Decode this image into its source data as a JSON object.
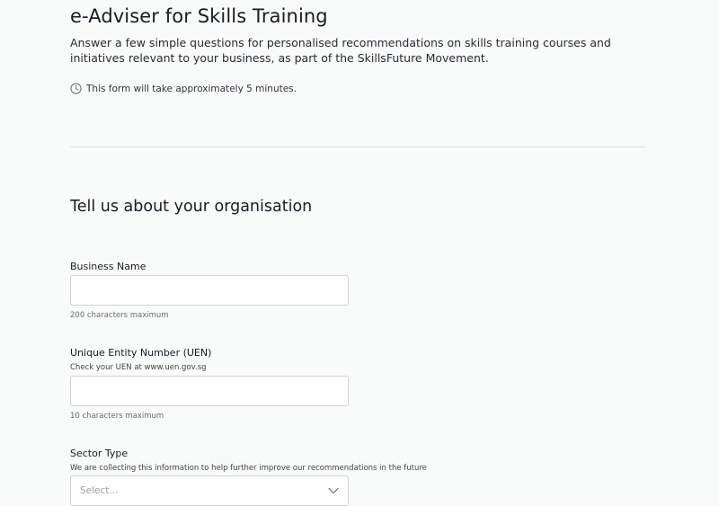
{
  "header": {
    "title": "e-Adviser for Skills Training",
    "intro": "Answer a few simple questions for personalised recommendations on skills training courses and initiatives relevant to your business, as part of the SkillsFuture Movement.",
    "timing_text": "This form will take approximately 5 minutes.",
    "timing_icon": "clock-icon"
  },
  "section": {
    "title": "Tell us about your organisation"
  },
  "fields": {
    "business_name": {
      "label": "Business Name",
      "value": "",
      "hint": "200 characters maximum"
    },
    "uen": {
      "label": "Unique Entity Number (UEN)",
      "help": "Check your UEN at www.uen.gov.sg",
      "value": "",
      "hint": "10 characters maximum"
    },
    "sector_type": {
      "label": "Sector Type",
      "help": "We are collecting this information to help further improve our recommendations in the future",
      "placeholder": "Select...",
      "icon": "chevron-down-icon"
    }
  }
}
